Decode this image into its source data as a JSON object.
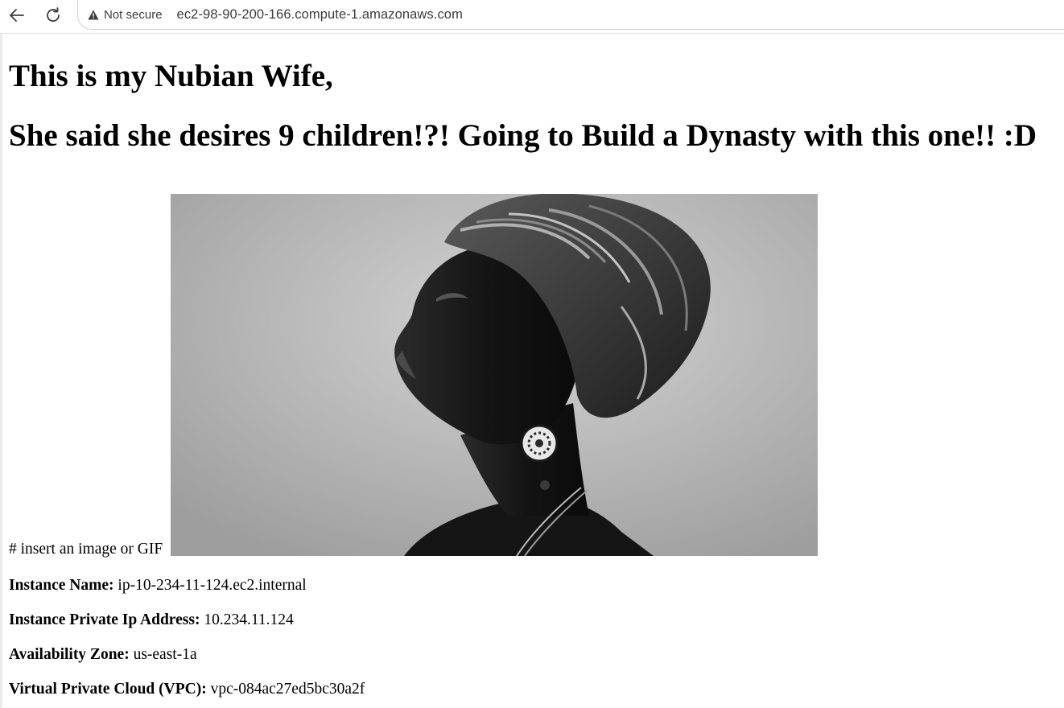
{
  "browser": {
    "security_label": "Not secure",
    "url": "ec2-98-90-200-166.compute-1.amazonaws.com",
    "back_icon": "back-arrow-icon",
    "reload_icon": "reload-icon",
    "warning_icon": "warning-triangle-icon"
  },
  "page": {
    "heading": "This is my Nubian Wife,",
    "subheading": "She said she desires 9 children!?! Going to Build a Dynasty with this one!! :D",
    "image_caption": "# insert an image or GIF"
  },
  "instance": {
    "name_label": "Instance Name:",
    "name_value": "ip-10-234-11-124.ec2.internal",
    "ip_label": "Instance Private Ip Address:",
    "ip_value": "10.234.11.124",
    "az_label": "Availability Zone:",
    "az_value": "us-east-1a",
    "vpc_label": "Virtual Private Cloud (VPC):",
    "vpc_value": "vpc-084ac27ed5bc30a2f"
  },
  "colors": {
    "text": "#000000",
    "chrome_text": "#3c3c3c",
    "background": "#ffffff"
  }
}
